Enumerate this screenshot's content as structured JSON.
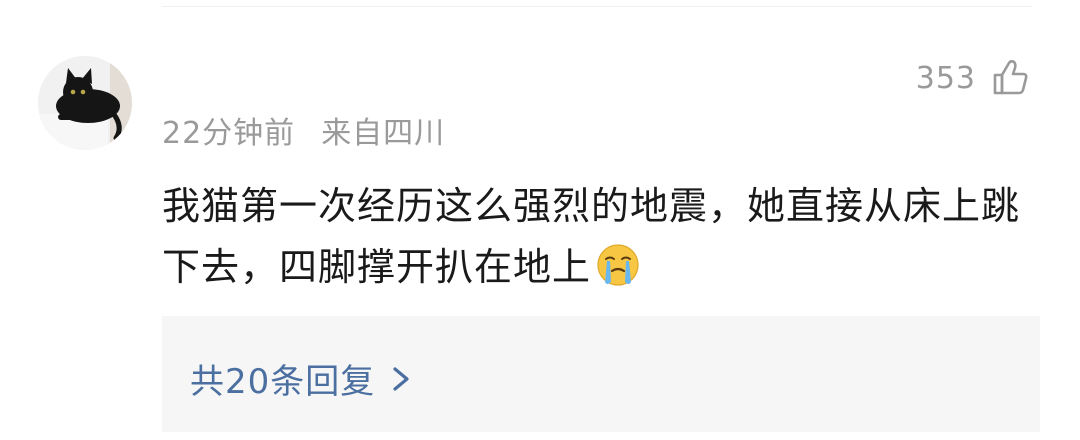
{
  "comment": {
    "time_ago": "22分钟前",
    "location": "来自四川",
    "like_count": "353",
    "text": "我猫第一次经历这么强烈的地震，她直接从床上跳下去，四脚撑开扒在地上",
    "emoji": "crying-face",
    "replies_label": "共20条回复"
  },
  "colors": {
    "meta_gray": "#9a9a9a",
    "text": "#1a1a1a",
    "link_blue": "#4a6fa0",
    "reply_bg": "#f6f6f6"
  },
  "icons": {
    "like": "thumbs-up-icon",
    "chevron": "chevron-right-icon"
  }
}
